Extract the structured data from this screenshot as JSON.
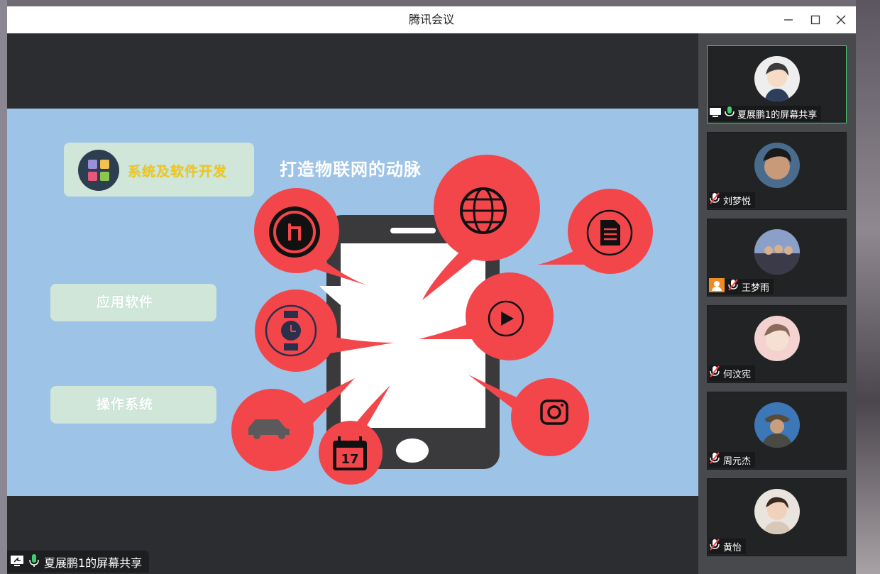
{
  "window": {
    "title": "腾讯会议"
  },
  "slide": {
    "title": "打造物联网的动脉",
    "top_pill_label": "系统及软件开发",
    "mid_pill_label": "应用软件",
    "bot_pill_label": "操作系统",
    "calendar_day": "17"
  },
  "share_bar": {
    "label": "夏展鹏1的屏幕共享"
  },
  "participants": [
    {
      "name": "夏展鹏1的屏幕共享",
      "muted": false,
      "sharing": true
    },
    {
      "name": "刘梦悦",
      "muted": true
    },
    {
      "name": "王梦雨",
      "muted": true,
      "placeholder_avatar": true
    },
    {
      "name": "何汶宪",
      "muted": true
    },
    {
      "name": "周元杰",
      "muted": true
    },
    {
      "name": "黄怡",
      "muted": true
    }
  ],
  "colors": {
    "slide_bg": "#9dc3e6",
    "bubble": "#f2464b",
    "accent_green": "#3ecf6a",
    "pill": "#cfe6d8"
  }
}
